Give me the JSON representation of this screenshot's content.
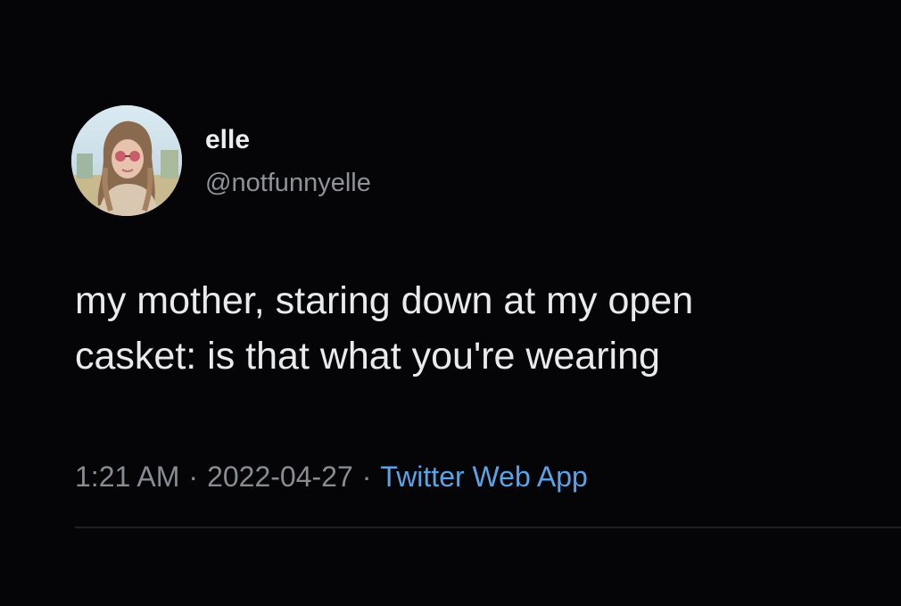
{
  "tweet": {
    "author": {
      "display_name": "elle",
      "handle": "@notfunnyelle",
      "avatar": "profile-photo"
    },
    "text_lines": [
      "my mother, staring down at my open",
      "casket: is that what you're wearing"
    ],
    "meta": {
      "time": "1:21 AM",
      "separator": "·",
      "date": "2022-04-27",
      "source": "Twitter Web App"
    }
  },
  "colors": {
    "background": "#050406",
    "text": "#e9eaeb",
    "secondary_text": "#868c92",
    "link": "#5aa4e6"
  }
}
